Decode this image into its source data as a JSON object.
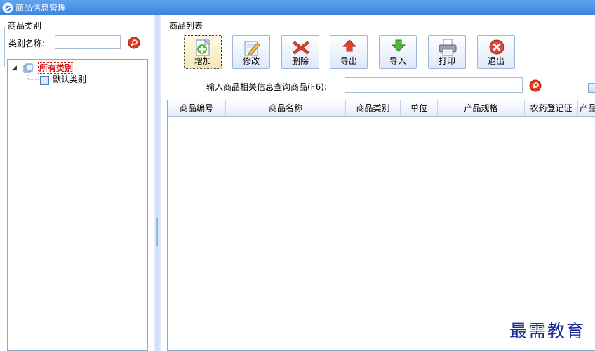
{
  "window": {
    "title": "商品信息管理"
  },
  "left": {
    "group_title": "商品类别",
    "category_label": "类别名称:",
    "category_value": "",
    "tree": {
      "root_label": "所有类别",
      "child_label": "默认类别"
    }
  },
  "right": {
    "group_title": "商品列表",
    "toolbar": {
      "add": "增加",
      "edit": "修改",
      "delete": "删除",
      "export": "导出",
      "import": "导入",
      "print": "打印",
      "exit": "退出"
    },
    "search_label": "输入商品相关信息查询商品(F6):",
    "search_value": "",
    "columns": [
      "商品编号",
      "商品名称",
      "商品类别",
      "单位",
      "产品规格",
      "农药登记证",
      "产品"
    ]
  },
  "watermark": "最需教育",
  "colors": {
    "title_bar": "#3d83dd",
    "accent_red": "#e01010",
    "border": "#8fa8c6"
  }
}
